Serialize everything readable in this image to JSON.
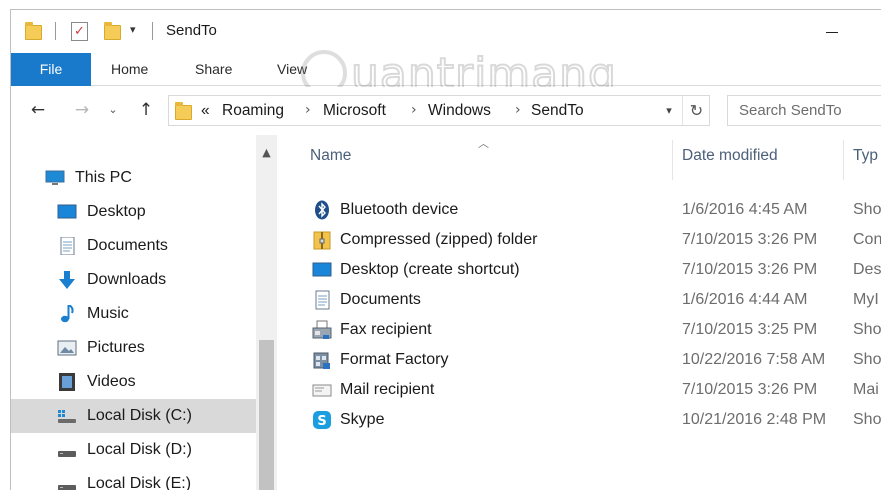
{
  "window": {
    "title": "SendTo"
  },
  "ribbon": {
    "tabs": [
      {
        "label": "File"
      },
      {
        "label": "Home"
      },
      {
        "label": "Share"
      },
      {
        "label": "View"
      }
    ]
  },
  "watermark": {
    "text": "uantrimang"
  },
  "address": {
    "overflow": "«",
    "segments": [
      "Roaming",
      "Microsoft",
      "Windows",
      "SendTo"
    ]
  },
  "search": {
    "placeholder": "Search SendTo"
  },
  "navpane": {
    "items": [
      {
        "label": "This PC",
        "icon": "computer-icon"
      },
      {
        "label": "Desktop",
        "icon": "desktop-icon"
      },
      {
        "label": "Documents",
        "icon": "documents-icon"
      },
      {
        "label": "Downloads",
        "icon": "download-arrow-icon"
      },
      {
        "label": "Music",
        "icon": "music-note-icon"
      },
      {
        "label": "Pictures",
        "icon": "pictures-icon"
      },
      {
        "label": "Videos",
        "icon": "film-icon"
      },
      {
        "label": "Local Disk (C:)",
        "icon": "windows-drive-icon",
        "selected": true
      },
      {
        "label": "Local Disk (D:)",
        "icon": "drive-icon"
      },
      {
        "label": "Local Disk (E:)",
        "icon": "drive-icon"
      }
    ]
  },
  "filelist": {
    "columns": {
      "name": "Name",
      "date": "Date modified",
      "type": "Typ"
    },
    "rows": [
      {
        "name": "Bluetooth device",
        "date": "1/6/2016 4:45 AM",
        "type": "Sho",
        "icon": "bluetooth-icon"
      },
      {
        "name": "Compressed (zipped) folder",
        "date": "7/10/2015 3:26 PM",
        "type": "Con",
        "icon": "zip-folder-icon"
      },
      {
        "name": "Desktop (create shortcut)",
        "date": "7/10/2015 3:26 PM",
        "type": "Des",
        "icon": "desktop-icon"
      },
      {
        "name": "Documents",
        "date": "1/6/2016 4:44 AM",
        "type": "MyI",
        "icon": "documents-icon"
      },
      {
        "name": "Fax recipient",
        "date": "7/10/2015 3:25 PM",
        "type": "Sho",
        "icon": "fax-icon"
      },
      {
        "name": "Format Factory",
        "date": "10/22/2016 7:58 AM",
        "type": "Sho",
        "icon": "format-factory-icon"
      },
      {
        "name": "Mail recipient",
        "date": "7/10/2015 3:26 PM",
        "type": "Mai",
        "icon": "mail-icon"
      },
      {
        "name": "Skype",
        "date": "10/21/2016 2:48 PM",
        "type": "Sho",
        "icon": "skype-icon"
      }
    ]
  },
  "colors": {
    "file_tab": "#1979ca",
    "selected": "#d9d9d9",
    "header_text": "#4c607a"
  }
}
